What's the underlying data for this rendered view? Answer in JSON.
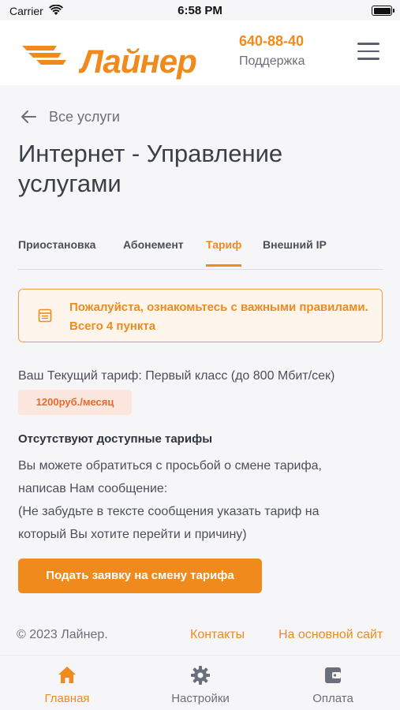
{
  "status_bar": {
    "carrier": "Carrier",
    "time": "6:58 PM"
  },
  "header": {
    "logo_text": "Лайнер",
    "support_phone": "640-88-40",
    "support_label": "Поддержка"
  },
  "navigation": {
    "back_label": "Все услуги"
  },
  "page": {
    "title": "Интернет - Управление услугами"
  },
  "tabs": [
    {
      "label": "Приостановка"
    },
    {
      "label": "Абонемент"
    },
    {
      "label": "Тариф"
    },
    {
      "label": "Внешний IP"
    }
  ],
  "notice": {
    "text": "Пожалуйста, ознакомьтесь с важными правилами. Всего 4 пункта"
  },
  "tariff": {
    "current": "Ваш Текущий тариф: Первый класс (до 800 Мбит/сек)",
    "price": "1200руб./месяц",
    "no_tariffs": "Отсутствуют доступные тарифы",
    "info_line1": "Вы можете обратиться с просьбой о смене тарифа,",
    "info_line2": "написав Нам сообщение:",
    "info_line3": "(Не забудьте в тексте сообщения указать тариф на",
    "info_line4": "который Вы хотите перейти и причину)",
    "request_button": "Подать заявку на смену тарифа"
  },
  "footer": {
    "copyright": "© 2023 Лайнер.",
    "contacts": "Контакты",
    "main_site": "На основной сайт"
  },
  "tab_bar": [
    {
      "label": "Главная",
      "icon": "home-icon",
      "active": true
    },
    {
      "label": "Настройки",
      "icon": "gear-icon",
      "active": false
    },
    {
      "label": "Оплата",
      "icon": "wallet-icon",
      "active": false
    }
  ],
  "colors": {
    "accent": "#f08a1c",
    "text": "#3a3f4a",
    "price_bg": "#fde6dd"
  }
}
